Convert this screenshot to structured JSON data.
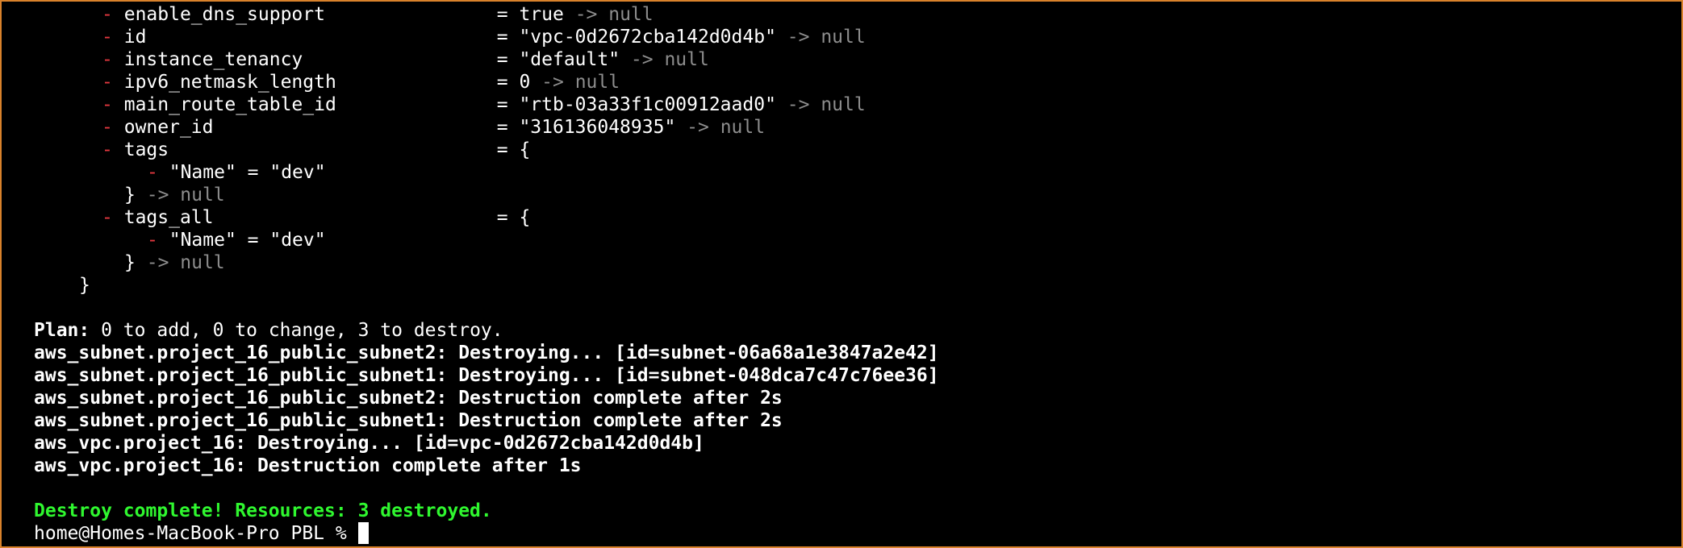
{
  "colors": {
    "background": "#000000",
    "frame": "#d9822b",
    "remove_marker": "#e4383f",
    "null_text": "#8d8d8d",
    "success": "#2ff72f"
  },
  "symbols": {
    "minus": "-",
    "arrow_null": "-> null",
    "equals": "=",
    "open_brace": "{",
    "close_brace": "}"
  },
  "attributes": [
    {
      "name": "enable_dns_support",
      "value": "true"
    },
    {
      "name": "id",
      "value": "\"vpc-0d2672cba142d0d4b\""
    },
    {
      "name": "instance_tenancy",
      "value": "\"default\""
    },
    {
      "name": "ipv6_netmask_length",
      "value": "0"
    },
    {
      "name": "main_route_table_id",
      "value": "\"rtb-03a33f1c00912aad0\""
    },
    {
      "name": "owner_id",
      "value": "\"316136048935\""
    }
  ],
  "tag_blocks": [
    {
      "name": "tags",
      "entry": "\"Name\" = \"dev\""
    },
    {
      "name": "tags_all",
      "entry": "\"Name\" = \"dev\""
    }
  ],
  "plan": {
    "label": "Plan:",
    "text": "0 to add, 0 to change, 3 to destroy."
  },
  "log_lines": [
    "aws_subnet.project_16_public_subnet2: Destroying... [id=subnet-06a68a1e3847a2e42]",
    "aws_subnet.project_16_public_subnet1: Destroying... [id=subnet-048dca7c47c76ee36]",
    "aws_subnet.project_16_public_subnet2: Destruction complete after 2s",
    "aws_subnet.project_16_public_subnet1: Destruction complete after 2s",
    "aws_vpc.project_16: Destroying... [id=vpc-0d2672cba142d0d4b]",
    "aws_vpc.project_16: Destruction complete after 1s"
  ],
  "result": "Destroy complete! Resources: 3 destroyed.",
  "prompt": "home@Homes-MacBook-Pro PBL %"
}
